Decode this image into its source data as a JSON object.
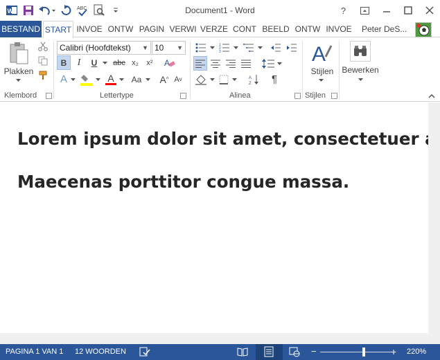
{
  "titlebar": {
    "title": "Document1 - Word",
    "icons": [
      "word-app-icon",
      "save-icon",
      "undo-icon",
      "redo-icon",
      "spelling-icon",
      "print-preview-icon",
      "customize-qat-icon"
    ],
    "help": "?"
  },
  "tabs": [
    {
      "label": "BESTAND"
    },
    {
      "label": "START"
    },
    {
      "label": "INVOE"
    },
    {
      "label": "ONTW"
    },
    {
      "label": "PAGIN"
    },
    {
      "label": "VERWI"
    },
    {
      "label": "VERZE"
    },
    {
      "label": "CONT"
    },
    {
      "label": "BEELD"
    },
    {
      "label": "ONTW"
    },
    {
      "label": "INVOE"
    }
  ],
  "user": {
    "name": "Peter DeS..."
  },
  "ribbon": {
    "clipboard": {
      "paste_label": "Plakken",
      "group_label": "Klembord"
    },
    "font": {
      "font_name": "Calibri (Hoofdtekst)",
      "font_size": "10",
      "group_label": "Lettertype",
      "bold": "B",
      "italic": "I",
      "underline": "U",
      "strike": "abc",
      "subscript": "x₂",
      "superscript": "x²",
      "text_effects": "A",
      "font_color": "A",
      "grow": "A",
      "shrink": "A",
      "case": "Aa"
    },
    "paragraph": {
      "group_label": "Alinea",
      "pilcrow": "¶"
    },
    "styles": {
      "label": "Stijlen",
      "group_label": "Stijlen"
    },
    "editing": {
      "label": "Bewerken"
    }
  },
  "document": {
    "paragraphs": [
      "Lorem ipsum dolor sit amet, consectetuer adipiscing elit.",
      "Maecenas porttitor congue massa."
    ]
  },
  "statusbar": {
    "page": "PAGINA 1 VAN 1",
    "words": "12 WOORDEN",
    "zoom": "220%",
    "zoom_minus": "−",
    "zoom_plus": "+"
  },
  "colors": {
    "accent": "#2b579a",
    "highlight": "#ffff00",
    "font_color": "#ff0000",
    "text": "#262626"
  }
}
